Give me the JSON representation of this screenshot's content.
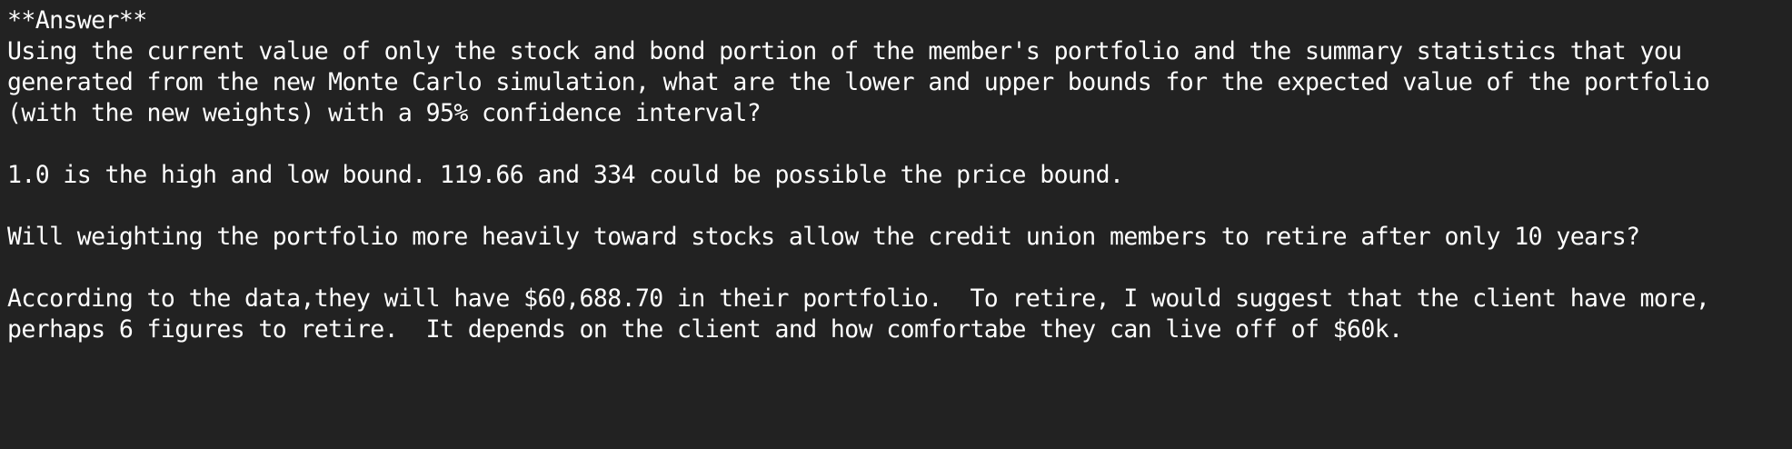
{
  "cell": {
    "heading": "**Answer**",
    "question1": [
      "Using the current value of only the stock and bond portion of the member's portfolio and the summary statistics that you",
      "generated from the new Monte Carlo simulation, what are the lower and upper bounds for the expected value of the portfolio",
      "(with the new weights) with a 95% confidence interval?"
    ],
    "answer1": "1.0 is the high and low bound. 119.66 and 334 could be possible the price bound.",
    "question2": "Will weighting the portfolio more heavily toward stocks allow the credit union members to retire after only 10 years?",
    "answer2": [
      "According to the data,they will have $60,688.70 in their portfolio.  To retire, I would suggest that the client have more,",
      "perhaps 6 figures to retire.  It depends on the client and how comfortabe they can live off of $60k."
    ]
  }
}
